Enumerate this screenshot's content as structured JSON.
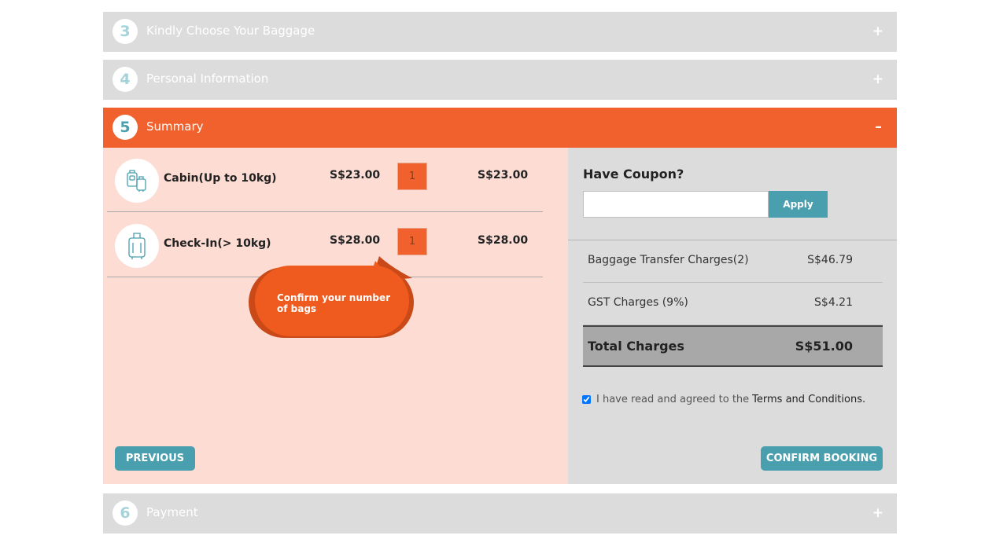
{
  "steps": {
    "baggage": {
      "number": "3",
      "title": "Kindly Choose Your Baggage"
    },
    "personal": {
      "number": "4",
      "title": "Personal Information"
    },
    "summary": {
      "number": "5",
      "title": "Summary"
    },
    "payment": {
      "number": "6",
      "title": "Payment"
    },
    "expand_symbol": "+",
    "collapse_symbol": "–"
  },
  "bags": [
    {
      "name": "Cabin(Up to 10kg)",
      "price": "S$23.00",
      "quantity": "1",
      "total": "S$23.00",
      "icon": "cabin-bags-icon"
    },
    {
      "name": "Check-In(> 10kg)",
      "price": "S$28.00",
      "quantity": "1",
      "total": "S$28.00",
      "icon": "suitcase-icon"
    }
  ],
  "tooltip": {
    "text": "Confirm your number of bags"
  },
  "coupon": {
    "title": "Have Coupon?",
    "placeholder": "",
    "apply_label": "Apply"
  },
  "charges": [
    {
      "label": "Baggage Transfer Charges(2)",
      "value": "S$46.79"
    },
    {
      "label": "GST Charges (9%)",
      "value": "S$4.21"
    }
  ],
  "total": {
    "label": "Total Charges",
    "value": "S$51.00"
  },
  "terms": {
    "text": "I have read and agreed to the",
    "link": "Terms and Conditions.",
    "checked": true
  },
  "buttons": {
    "previous": "PREVIOUS",
    "confirm": "CONFIRM BOOKING"
  },
  "colors": {
    "accent": "#f0612d",
    "teal": "#4a9fae",
    "panel_light": "#fcdcd3",
    "panel_grey": "#dcdcdc"
  }
}
